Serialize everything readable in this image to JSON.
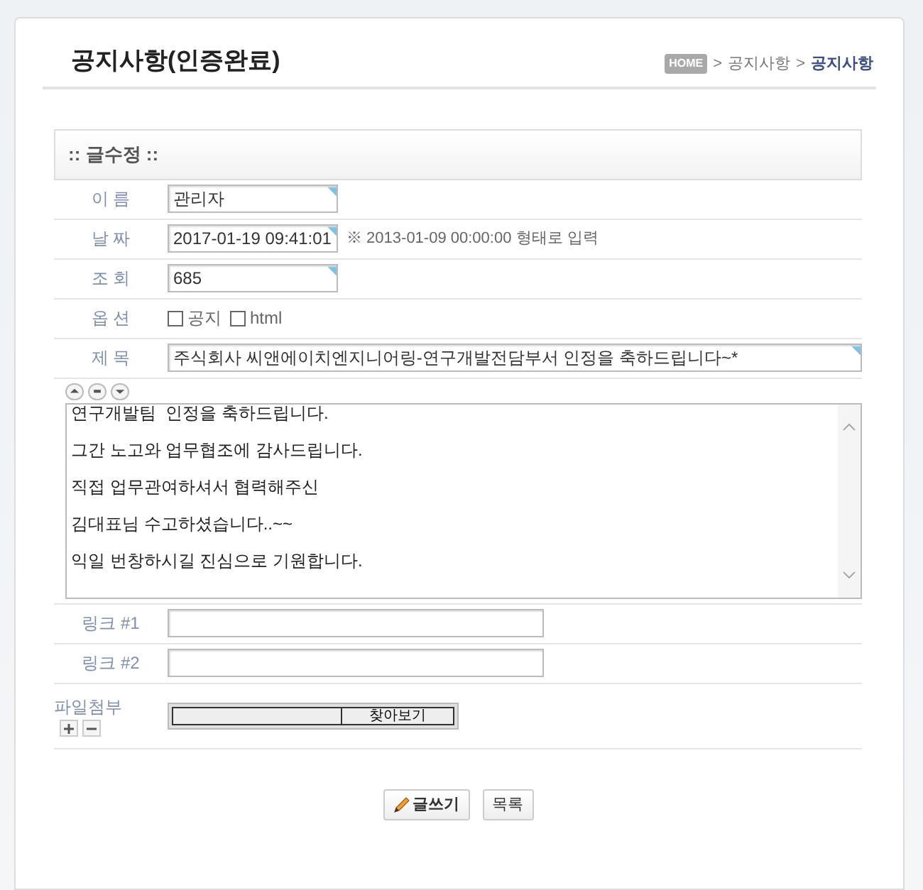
{
  "page_title": "공지사항(인증완료)",
  "breadcrumb": [
    {
      "kind": "home",
      "label": "HOME"
    },
    {
      "kind": "sep",
      "label": ">"
    },
    {
      "kind": "link",
      "label": "공지사항"
    },
    {
      "kind": "sep",
      "label": ">"
    },
    {
      "kind": "current",
      "label": "공지사항"
    }
  ],
  "section_title": ":: 글수정 ::",
  "fields": [
    {
      "kind": "text",
      "label": "이 름",
      "value": "관리자"
    },
    {
      "kind": "text",
      "label": "날 짜",
      "value": "2017-01-19 09:41:01",
      "hint": "※ 2013-01-09 00:00:00 형태로 입력"
    },
    {
      "kind": "text",
      "label": "조 회",
      "value": "685"
    },
    {
      "kind": "options",
      "label": "옵 션",
      "options": [
        {
          "label": "공지",
          "checked": false
        },
        {
          "label": "html",
          "checked": false
        }
      ]
    },
    {
      "kind": "wide",
      "label": "제 목",
      "value": "주식회사 씨앤에이치엔지니어링-연구개발전담부서 인정을 축하드립니다~*"
    }
  ],
  "content": "연구개발팀  인정을 축하드립니다.\n\n그간 노고와 업무협조에 감사드립니다.\n\n직접 업무관여하셔서 협력해주신\n\n김대표님 수고하셨습니다..~~\n\n익일 번창하시길 진심으로 기원합니다.",
  "links": [
    {
      "label": "링크 #1"
    },
    {
      "label": "링크 #2"
    }
  ],
  "attachment": {
    "label": "파일첨부",
    "browse": "찾아보기"
  },
  "buttons": [
    {
      "kind": "write",
      "label": "글쓰기"
    },
    {
      "kind": "list",
      "label": "목록"
    }
  ]
}
